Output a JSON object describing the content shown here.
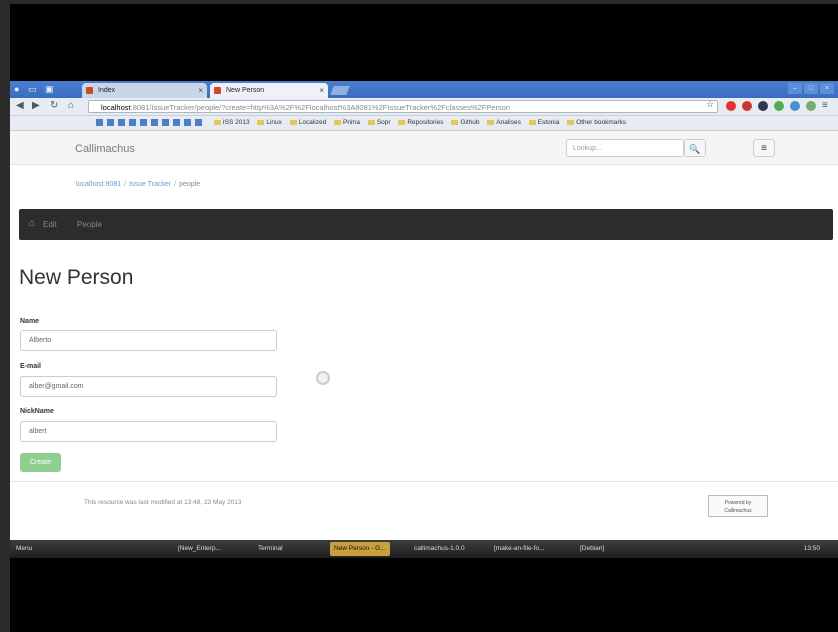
{
  "browser": {
    "tabs": [
      {
        "label": "Index"
      },
      {
        "label": "New Person"
      }
    ],
    "url_host": "localhost",
    "url_rest": ":8081/IssueTracker/people/?create=http%3A%2F%2Flocalhost%3A8081%2FIssueTracker%2Fclasses%2FPerson",
    "bookmarks": [
      "ISS 2013",
      "Linux",
      "Localized",
      "Prima",
      "Sopr",
      "Repositories",
      "Github",
      "Analises",
      "Estonia",
      "Other bookmarks"
    ]
  },
  "app": {
    "brand": "Callimachus",
    "lookup_placeholder": "Lookup...",
    "breadcrumb": [
      "localhost:8081",
      "Issue Tracker",
      "people"
    ],
    "navbar": {
      "items": [
        "Edit",
        "People"
      ]
    }
  },
  "form": {
    "title": "New Person",
    "name_label": "Name",
    "name_value": "Alberto",
    "email_label": "E-mail",
    "email_value": "alber@gmail.com",
    "nickname_label": "NickName",
    "nickname_value": "albert",
    "create_button": "Create"
  },
  "footer": {
    "text": "This resource was last modified at 13:48, 23 May 2013",
    "badge_line1": "Powered by",
    "badge_line2": "Callimachus"
  },
  "taskbar": {
    "items": [
      "Menu",
      "[New_Enterp...",
      "Terminal",
      "New Person - G...",
      "callimachus-1.0.0",
      "[make-an-file-fo...",
      "[Debian]"
    ],
    "clock": "13:50"
  }
}
